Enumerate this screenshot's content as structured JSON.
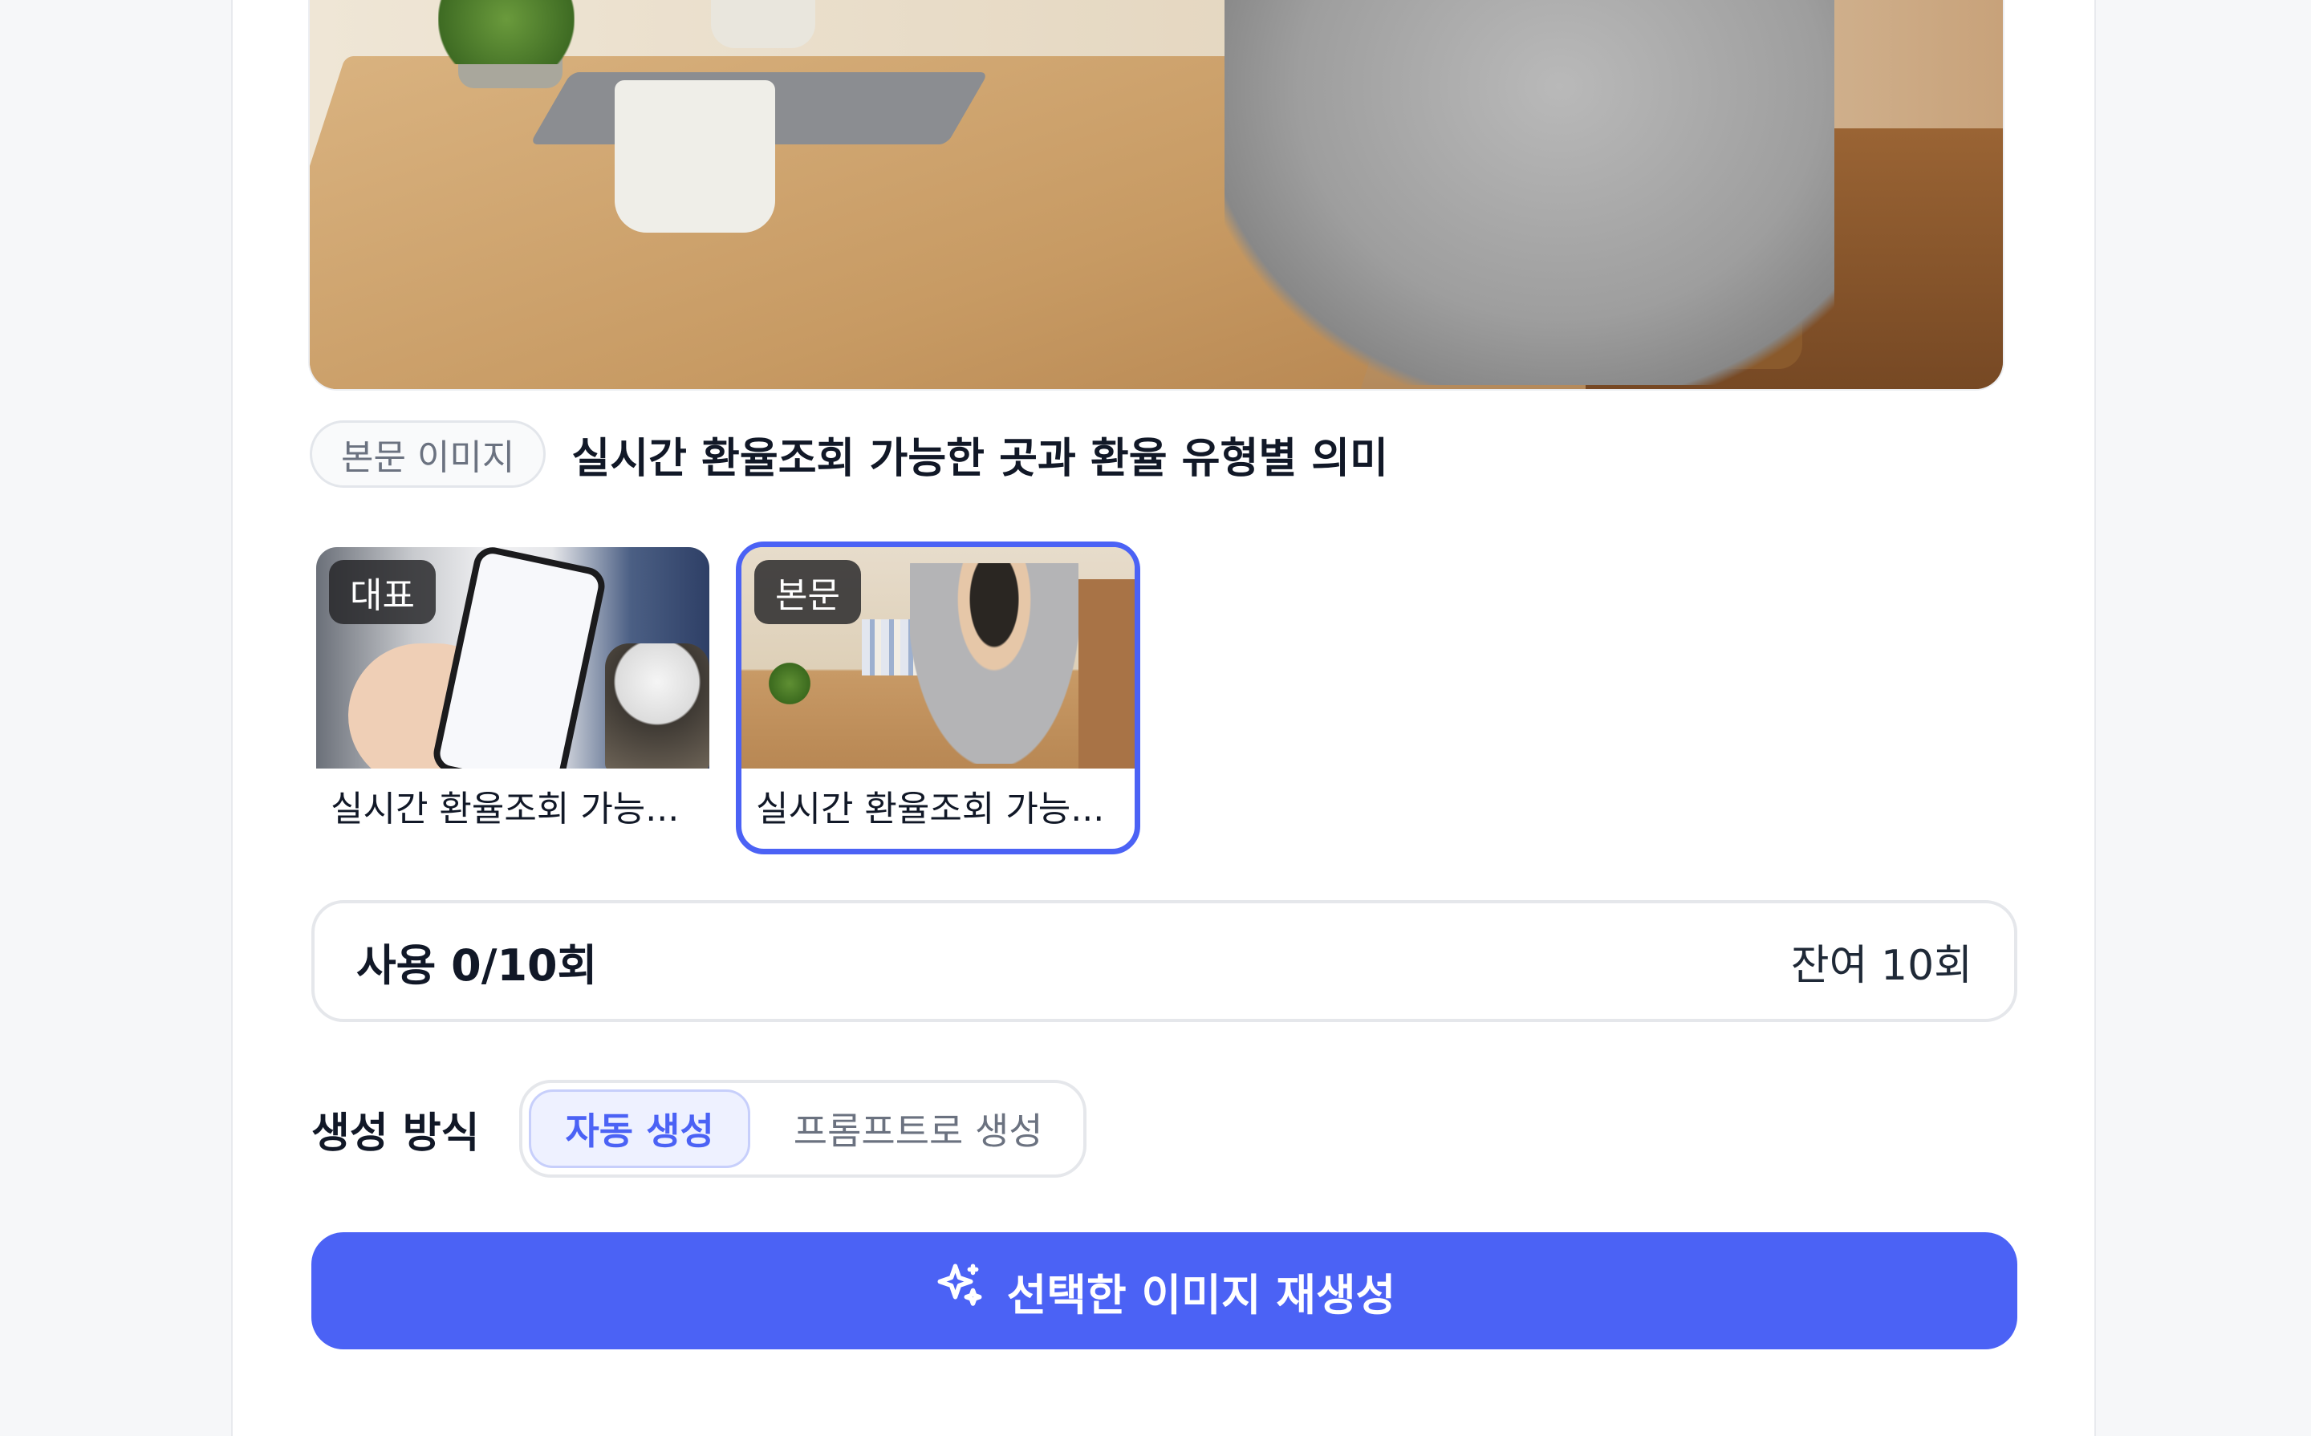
{
  "preview": {
    "section_pill": "본문 이미지",
    "title": "실시간 환율조회 가능한 곳과 환율 유형별 의미"
  },
  "thumbnails": [
    {
      "badge": "대표",
      "caption": "실시간 환율조회 가능...",
      "selected": false
    },
    {
      "badge": "본문",
      "caption": "실시간 환율조회 가능...",
      "selected": true
    }
  ],
  "usage": {
    "used_label": "사용 0/10회",
    "remaining_label": "잔여 10회"
  },
  "mode": {
    "label": "생성 방식",
    "options": [
      {
        "label": "자동 생성",
        "active": true
      },
      {
        "label": "프롬프트로 생성",
        "active": false
      }
    ]
  },
  "cta": {
    "label": "선택한 이미지 재생성",
    "icon": "sparkle-icon"
  },
  "colors": {
    "accent": "#4b62f5",
    "accent_soft": "#eef1ff",
    "border": "#e5e7eb"
  }
}
